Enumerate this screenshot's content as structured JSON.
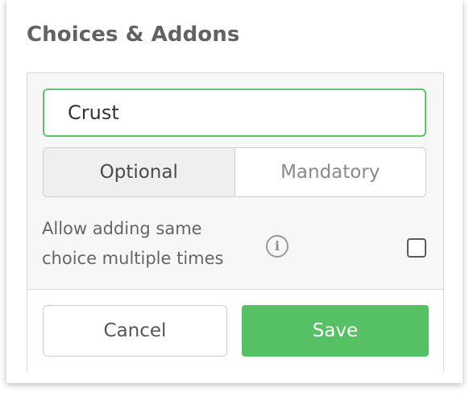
{
  "header": {
    "title": "Choices & Addons"
  },
  "group_name_input": {
    "value": "Crust"
  },
  "requirement_toggle": {
    "selected": "Optional",
    "options": [
      "Optional",
      "Mandatory"
    ]
  },
  "allow_multiple": {
    "label": "Allow adding same choice multiple times",
    "info_icon": "info-icon",
    "checked": false
  },
  "footer": {
    "cancel_label": "Cancel",
    "save_label": "Save"
  },
  "colors": {
    "accent_green": "#56c064",
    "input_border_green": "#5fc46a",
    "title_gray": "#626262"
  }
}
